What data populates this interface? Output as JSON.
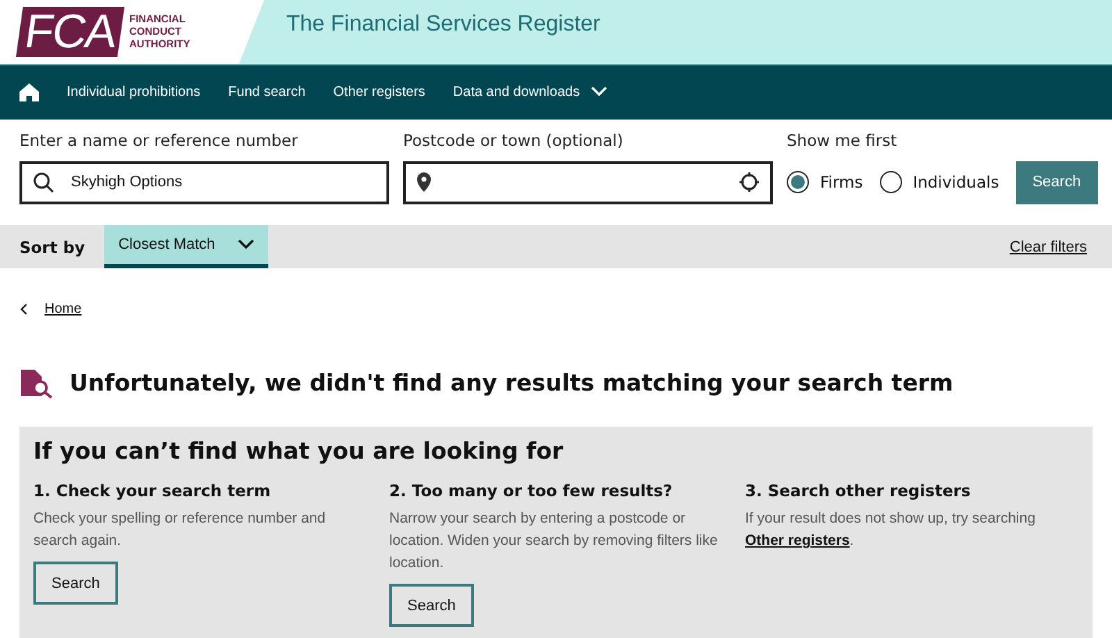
{
  "logo": {
    "letters": "FCA",
    "lines": [
      "FINANCIAL",
      "CONDUCT",
      "AUTHORITY"
    ]
  },
  "header": {
    "title": "The Financial Services Register"
  },
  "nav": {
    "items": [
      {
        "label": "Individual prohibitions",
        "kind": "link"
      },
      {
        "label": "Fund search",
        "kind": "link"
      },
      {
        "label": "Other registers",
        "kind": "link"
      },
      {
        "label": "Data and downloads",
        "kind": "dropdown"
      }
    ]
  },
  "search": {
    "name_label": "Enter a name or reference number",
    "name_value": "Skyhigh Options",
    "postcode_label": "Postcode or town (optional)",
    "show_label": "Show me first",
    "options": [
      {
        "label": "Firms",
        "selected": true
      },
      {
        "label": "Individuals",
        "selected": false
      }
    ],
    "button": "Search"
  },
  "sort": {
    "label": "Sort by",
    "value": "Closest Match",
    "clear": "Clear filters"
  },
  "breadcrumb": "Home",
  "message": "Unfortunately, we didn't find any results matching your search term",
  "help": {
    "title": "If you can’t find what you are looking for",
    "columns": [
      {
        "heading": "1. Check your search term",
        "text": "Check your spelling or reference number and search again.",
        "button": "Search"
      },
      {
        "heading": "2. Too many or too few results?",
        "text": "Narrow your search by entering a postcode or location. Widen your search by removing filters like location.",
        "button": "Search"
      },
      {
        "heading": "3. Search other registers",
        "text": "If your result does not show up, try searching",
        "link": "Other registers",
        "after": "."
      }
    ]
  }
}
